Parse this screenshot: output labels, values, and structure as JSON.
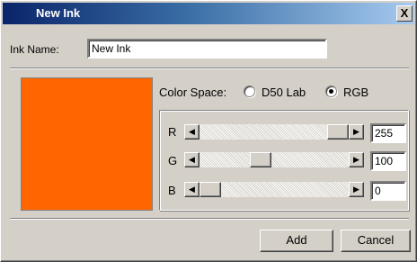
{
  "window": {
    "title": "New Ink",
    "close_glyph": "X"
  },
  "ink_name": {
    "label": "Ink Name:",
    "value": "New Ink"
  },
  "swatch": {
    "color": "#ff6600"
  },
  "color_space": {
    "label": "Color Space:",
    "options": [
      {
        "label": "D50 Lab",
        "selected": false
      },
      {
        "label": "RGB",
        "selected": true
      }
    ]
  },
  "channels": [
    {
      "name": "R",
      "value": "255",
      "max": 255
    },
    {
      "name": "G",
      "value": "100",
      "max": 255
    },
    {
      "name": "B",
      "value": "0",
      "max": 255
    }
  ],
  "buttons": {
    "add": "Add",
    "cancel": "Cancel"
  },
  "icons": {
    "scroll_left": "arrow-left-icon",
    "scroll_right": "arrow-right-icon"
  }
}
